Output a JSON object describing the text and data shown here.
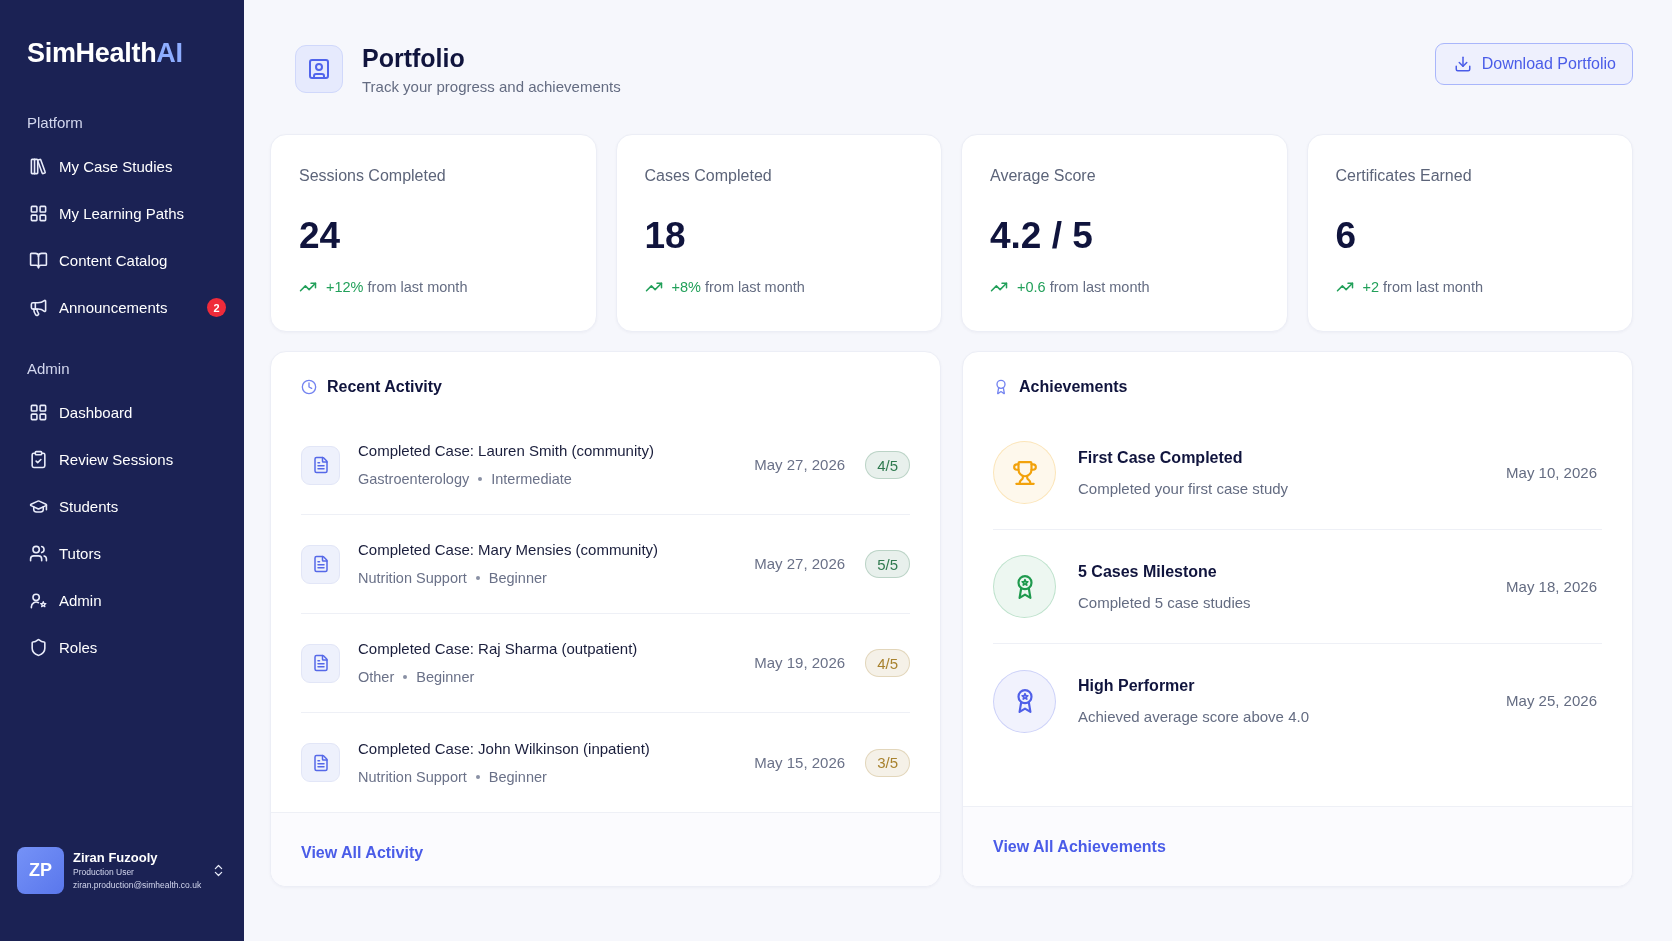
{
  "sidebar": {
    "logo": {
      "name": "SimHealth",
      "accent": "AI"
    },
    "sections": [
      {
        "label": "Platform",
        "items": [
          {
            "label": "My Case Studies"
          },
          {
            "label": "My Learning Paths"
          },
          {
            "label": "Content Catalog"
          },
          {
            "label": "Announcements",
            "badge": "2"
          }
        ]
      },
      {
        "label": "Admin",
        "items": [
          {
            "label": "Dashboard"
          },
          {
            "label": "Review Sessions"
          },
          {
            "label": "Students"
          },
          {
            "label": "Tutors"
          },
          {
            "label": "Admin"
          },
          {
            "label": "Roles"
          }
        ]
      }
    ],
    "user": {
      "initials": "ZP",
      "name": "Ziran Fuzooly",
      "role": "Production User",
      "email": "ziran.production@simhealth.co.uk"
    }
  },
  "header": {
    "title": "Portfolio",
    "subtitle": "Track your progress and achievements",
    "action": "Download Portfolio"
  },
  "stats": [
    {
      "label": "Sessions Completed",
      "value": "24",
      "change": "+12%",
      "note": "from last month"
    },
    {
      "label": "Cases Completed",
      "value": "18",
      "change": "+8%",
      "note": "from last month"
    },
    {
      "label": "Average Score",
      "value": "4.2 / 5",
      "change": "+0.6",
      "note": "from last month"
    },
    {
      "label": "Certificates Earned",
      "value": "6",
      "change": "+2",
      "note": "from last month"
    }
  ],
  "recent_activity": {
    "title": "Recent Activity",
    "items": [
      {
        "title": "Completed Case: Lauren Smith (community)",
        "category": "Gastroenterology",
        "level": "Intermediate",
        "date": "May 27, 2026",
        "score": "4/5",
        "color": "#2f7a4f"
      },
      {
        "title": "Completed Case: Mary Mensies (community)",
        "category": "Nutrition Support",
        "level": "Beginner",
        "date": "May 27, 2026",
        "score": "5/5",
        "color": "#2f7a4f"
      },
      {
        "title": "Completed Case: Raj Sharma (outpatient)",
        "category": "Other",
        "level": "Beginner",
        "date": "May 19, 2026",
        "score": "4/5",
        "color": "#a8822e"
      },
      {
        "title": "Completed Case: John Wilkinson (inpatient)",
        "category": "Nutrition Support",
        "level": "Beginner",
        "date": "May 15, 2026",
        "score": "3/5",
        "color": "#a8822e"
      }
    ],
    "link": "View All Activity"
  },
  "achievements": {
    "title": "Achievements",
    "items": [
      {
        "kind": "trophy",
        "title": "First Case Completed",
        "description": "Completed your first case study",
        "date": "May 10, 2026",
        "color": "#f2a20c"
      },
      {
        "kind": "award",
        "title": "5 Cases Milestone",
        "description": "Completed 5 case studies",
        "date": "May 18, 2026",
        "color": "#1f9a4e"
      },
      {
        "kind": "award",
        "title": "High Performer",
        "description": "Achieved average score above 4.0",
        "date": "May 25, 2026",
        "color": "#4f5fe8"
      }
    ],
    "link": "View All Achievements"
  }
}
